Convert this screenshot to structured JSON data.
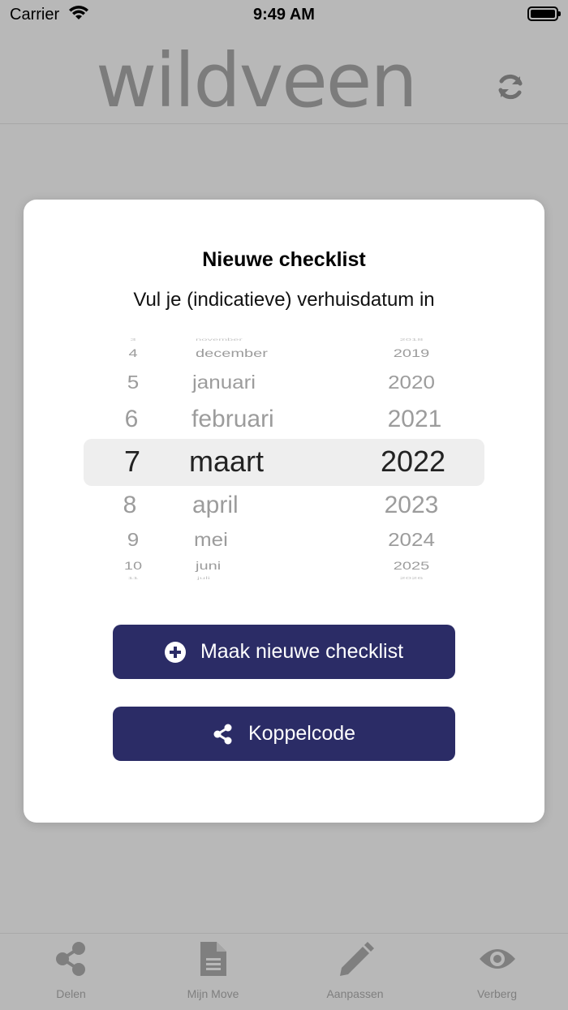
{
  "status_bar": {
    "carrier": "Carrier",
    "time": "9:49 AM"
  },
  "header": {
    "logo_text": "wildveen",
    "refresh_icon": "refresh-icon"
  },
  "modal": {
    "title": "Nieuwe checklist",
    "subtitle": "Vul je (indicatieve) verhuisdatum in",
    "picker": {
      "rows": [
        {
          "day": "3",
          "month": "november",
          "year": "2018"
        },
        {
          "day": "4",
          "month": "december",
          "year": "2019"
        },
        {
          "day": "5",
          "month": "januari",
          "year": "2020"
        },
        {
          "day": "6",
          "month": "februari",
          "year": "2021"
        },
        {
          "day": "7",
          "month": "maart",
          "year": "2022"
        },
        {
          "day": "8",
          "month": "april",
          "year": "2023"
        },
        {
          "day": "9",
          "month": "mei",
          "year": "2024"
        },
        {
          "day": "10",
          "month": "juni",
          "year": "2025"
        },
        {
          "day": "11",
          "month": "juli",
          "year": "2026"
        }
      ],
      "selected": {
        "day": "7",
        "month": "maart",
        "year": "2022"
      }
    },
    "create_button": {
      "label": "Maak nieuwe checklist",
      "icon": "plus-circle-icon"
    },
    "pair_button": {
      "label": "Koppelcode",
      "icon": "share-icon"
    }
  },
  "tabbar": {
    "tabs": [
      {
        "label": "Delen",
        "icon": "share-icon"
      },
      {
        "label": "Mijn Move",
        "icon": "document-icon"
      },
      {
        "label": "Aanpassen",
        "icon": "pencil-icon"
      },
      {
        "label": "Verberg",
        "icon": "eye-icon"
      }
    ]
  },
  "colors": {
    "button": "#2b2c66",
    "overlay": "#b8b8b8",
    "muted_text": "#7f7f7f"
  }
}
